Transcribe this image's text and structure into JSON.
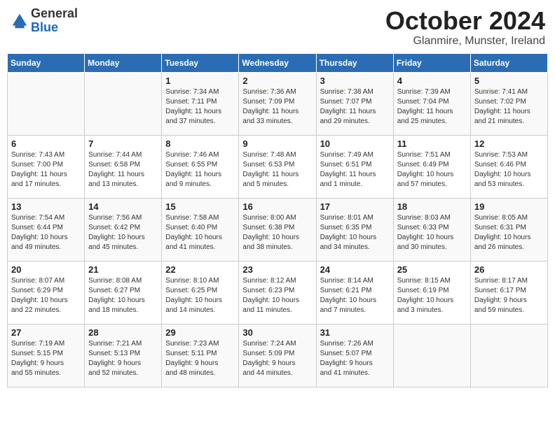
{
  "logo": {
    "general": "General",
    "blue": "Blue"
  },
  "title": "October 2024",
  "location": "Glanmire, Munster, Ireland",
  "weekdays": [
    "Sunday",
    "Monday",
    "Tuesday",
    "Wednesday",
    "Thursday",
    "Friday",
    "Saturday"
  ],
  "weeks": [
    [
      {
        "day": "",
        "info": ""
      },
      {
        "day": "",
        "info": ""
      },
      {
        "day": "1",
        "info": "Sunrise: 7:34 AM\nSunset: 7:11 PM\nDaylight: 11 hours\nand 37 minutes."
      },
      {
        "day": "2",
        "info": "Sunrise: 7:36 AM\nSunset: 7:09 PM\nDaylight: 11 hours\nand 33 minutes."
      },
      {
        "day": "3",
        "info": "Sunrise: 7:38 AM\nSunset: 7:07 PM\nDaylight: 11 hours\nand 29 minutes."
      },
      {
        "day": "4",
        "info": "Sunrise: 7:39 AM\nSunset: 7:04 PM\nDaylight: 11 hours\nand 25 minutes."
      },
      {
        "day": "5",
        "info": "Sunrise: 7:41 AM\nSunset: 7:02 PM\nDaylight: 11 hours\nand 21 minutes."
      }
    ],
    [
      {
        "day": "6",
        "info": "Sunrise: 7:43 AM\nSunset: 7:00 PM\nDaylight: 11 hours\nand 17 minutes."
      },
      {
        "day": "7",
        "info": "Sunrise: 7:44 AM\nSunset: 6:58 PM\nDaylight: 11 hours\nand 13 minutes."
      },
      {
        "day": "8",
        "info": "Sunrise: 7:46 AM\nSunset: 6:55 PM\nDaylight: 11 hours\nand 9 minutes."
      },
      {
        "day": "9",
        "info": "Sunrise: 7:48 AM\nSunset: 6:53 PM\nDaylight: 11 hours\nand 5 minutes."
      },
      {
        "day": "10",
        "info": "Sunrise: 7:49 AM\nSunset: 6:51 PM\nDaylight: 11 hours\nand 1 minute."
      },
      {
        "day": "11",
        "info": "Sunrise: 7:51 AM\nSunset: 6:49 PM\nDaylight: 10 hours\nand 57 minutes."
      },
      {
        "day": "12",
        "info": "Sunrise: 7:53 AM\nSunset: 6:46 PM\nDaylight: 10 hours\nand 53 minutes."
      }
    ],
    [
      {
        "day": "13",
        "info": "Sunrise: 7:54 AM\nSunset: 6:44 PM\nDaylight: 10 hours\nand 49 minutes."
      },
      {
        "day": "14",
        "info": "Sunrise: 7:56 AM\nSunset: 6:42 PM\nDaylight: 10 hours\nand 45 minutes."
      },
      {
        "day": "15",
        "info": "Sunrise: 7:58 AM\nSunset: 6:40 PM\nDaylight: 10 hours\nand 41 minutes."
      },
      {
        "day": "16",
        "info": "Sunrise: 8:00 AM\nSunset: 6:38 PM\nDaylight: 10 hours\nand 38 minutes."
      },
      {
        "day": "17",
        "info": "Sunrise: 8:01 AM\nSunset: 6:35 PM\nDaylight: 10 hours\nand 34 minutes."
      },
      {
        "day": "18",
        "info": "Sunrise: 8:03 AM\nSunset: 6:33 PM\nDaylight: 10 hours\nand 30 minutes."
      },
      {
        "day": "19",
        "info": "Sunrise: 8:05 AM\nSunset: 6:31 PM\nDaylight: 10 hours\nand 26 minutes."
      }
    ],
    [
      {
        "day": "20",
        "info": "Sunrise: 8:07 AM\nSunset: 6:29 PM\nDaylight: 10 hours\nand 22 minutes."
      },
      {
        "day": "21",
        "info": "Sunrise: 8:08 AM\nSunset: 6:27 PM\nDaylight: 10 hours\nand 18 minutes."
      },
      {
        "day": "22",
        "info": "Sunrise: 8:10 AM\nSunset: 6:25 PM\nDaylight: 10 hours\nand 14 minutes."
      },
      {
        "day": "23",
        "info": "Sunrise: 8:12 AM\nSunset: 6:23 PM\nDaylight: 10 hours\nand 11 minutes."
      },
      {
        "day": "24",
        "info": "Sunrise: 8:14 AM\nSunset: 6:21 PM\nDaylight: 10 hours\nand 7 minutes."
      },
      {
        "day": "25",
        "info": "Sunrise: 8:15 AM\nSunset: 6:19 PM\nDaylight: 10 hours\nand 3 minutes."
      },
      {
        "day": "26",
        "info": "Sunrise: 8:17 AM\nSunset: 6:17 PM\nDaylight: 9 hours\nand 59 minutes."
      }
    ],
    [
      {
        "day": "27",
        "info": "Sunrise: 7:19 AM\nSunset: 5:15 PM\nDaylight: 9 hours\nand 55 minutes."
      },
      {
        "day": "28",
        "info": "Sunrise: 7:21 AM\nSunset: 5:13 PM\nDaylight: 9 hours\nand 52 minutes."
      },
      {
        "day": "29",
        "info": "Sunrise: 7:23 AM\nSunset: 5:11 PM\nDaylight: 9 hours\nand 48 minutes."
      },
      {
        "day": "30",
        "info": "Sunrise: 7:24 AM\nSunset: 5:09 PM\nDaylight: 9 hours\nand 44 minutes."
      },
      {
        "day": "31",
        "info": "Sunrise: 7:26 AM\nSunset: 5:07 PM\nDaylight: 9 hours\nand 41 minutes."
      },
      {
        "day": "",
        "info": ""
      },
      {
        "day": "",
        "info": ""
      }
    ]
  ]
}
